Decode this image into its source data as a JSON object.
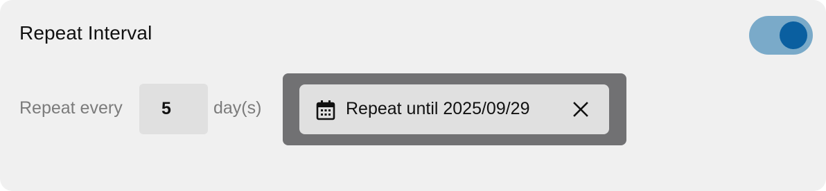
{
  "section": {
    "title": "Repeat Interval",
    "toggle_on": true
  },
  "repeat": {
    "label": "Repeat every",
    "interval_value": "5",
    "unit_label": "day(s)"
  },
  "until_chip": {
    "label": "Repeat until 2025/09/29",
    "leading_icon": "calendar-icon",
    "trailing_icon": "close-icon"
  },
  "colors": {
    "card_background": "#f0f0f0",
    "toggle_track": "#7aaac9",
    "toggle_knob": "#0a5fa0",
    "focus_frame": "#717173",
    "chip_background": "#e0e0e0",
    "muted_text": "#7b7b7b"
  }
}
